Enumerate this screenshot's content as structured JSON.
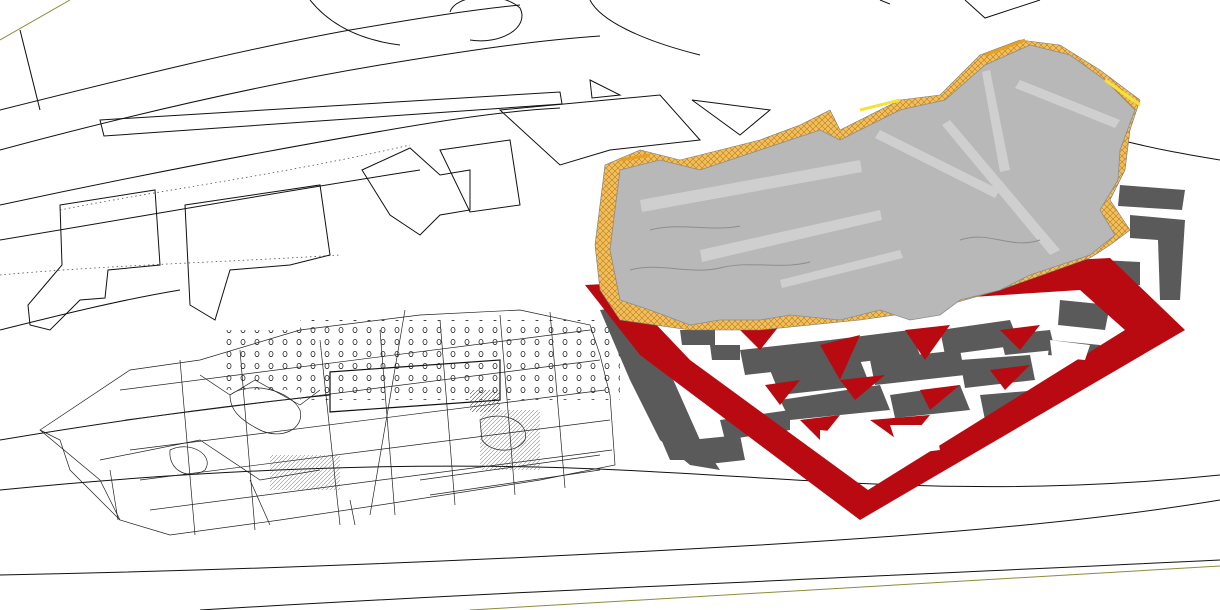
{
  "scene": {
    "kind": "3d-site-model",
    "colors": {
      "background": "#ffffff",
      "linework": "#111111",
      "buildings": "#5a5a5a",
      "plinth": "#b80a10",
      "roof": "#b8b8b8",
      "roof_edge_warm": "#e8a020",
      "roof_edge_yellow": "#f2e33a",
      "grid_line": "#8c8c3a"
    }
  }
}
